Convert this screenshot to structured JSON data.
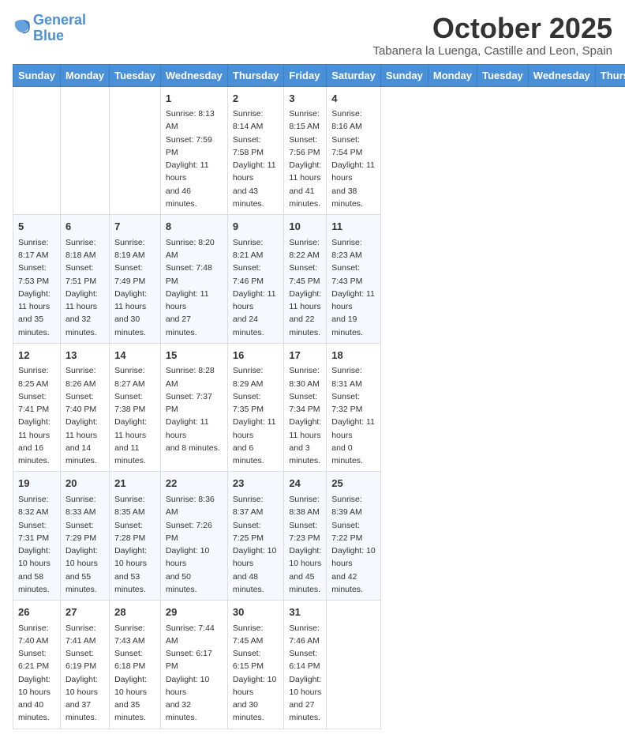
{
  "header": {
    "logo_line1": "General",
    "logo_line2": "Blue",
    "month": "October 2025",
    "location": "Tabanera la Luenga, Castille and Leon, Spain"
  },
  "days_of_week": [
    "Sunday",
    "Monday",
    "Tuesday",
    "Wednesday",
    "Thursday",
    "Friday",
    "Saturday"
  ],
  "weeks": [
    [
      {
        "day": "",
        "info": ""
      },
      {
        "day": "",
        "info": ""
      },
      {
        "day": "",
        "info": ""
      },
      {
        "day": "1",
        "info": "Sunrise: 8:13 AM\nSunset: 7:59 PM\nDaylight: 11 hours\nand 46 minutes."
      },
      {
        "day": "2",
        "info": "Sunrise: 8:14 AM\nSunset: 7:58 PM\nDaylight: 11 hours\nand 43 minutes."
      },
      {
        "day": "3",
        "info": "Sunrise: 8:15 AM\nSunset: 7:56 PM\nDaylight: 11 hours\nand 41 minutes."
      },
      {
        "day": "4",
        "info": "Sunrise: 8:16 AM\nSunset: 7:54 PM\nDaylight: 11 hours\nand 38 minutes."
      }
    ],
    [
      {
        "day": "5",
        "info": "Sunrise: 8:17 AM\nSunset: 7:53 PM\nDaylight: 11 hours\nand 35 minutes."
      },
      {
        "day": "6",
        "info": "Sunrise: 8:18 AM\nSunset: 7:51 PM\nDaylight: 11 hours\nand 32 minutes."
      },
      {
        "day": "7",
        "info": "Sunrise: 8:19 AM\nSunset: 7:49 PM\nDaylight: 11 hours\nand 30 minutes."
      },
      {
        "day": "8",
        "info": "Sunrise: 8:20 AM\nSunset: 7:48 PM\nDaylight: 11 hours\nand 27 minutes."
      },
      {
        "day": "9",
        "info": "Sunrise: 8:21 AM\nSunset: 7:46 PM\nDaylight: 11 hours\nand 24 minutes."
      },
      {
        "day": "10",
        "info": "Sunrise: 8:22 AM\nSunset: 7:45 PM\nDaylight: 11 hours\nand 22 minutes."
      },
      {
        "day": "11",
        "info": "Sunrise: 8:23 AM\nSunset: 7:43 PM\nDaylight: 11 hours\nand 19 minutes."
      }
    ],
    [
      {
        "day": "12",
        "info": "Sunrise: 8:25 AM\nSunset: 7:41 PM\nDaylight: 11 hours\nand 16 minutes."
      },
      {
        "day": "13",
        "info": "Sunrise: 8:26 AM\nSunset: 7:40 PM\nDaylight: 11 hours\nand 14 minutes."
      },
      {
        "day": "14",
        "info": "Sunrise: 8:27 AM\nSunset: 7:38 PM\nDaylight: 11 hours\nand 11 minutes."
      },
      {
        "day": "15",
        "info": "Sunrise: 8:28 AM\nSunset: 7:37 PM\nDaylight: 11 hours\nand 8 minutes."
      },
      {
        "day": "16",
        "info": "Sunrise: 8:29 AM\nSunset: 7:35 PM\nDaylight: 11 hours\nand 6 minutes."
      },
      {
        "day": "17",
        "info": "Sunrise: 8:30 AM\nSunset: 7:34 PM\nDaylight: 11 hours\nand 3 minutes."
      },
      {
        "day": "18",
        "info": "Sunrise: 8:31 AM\nSunset: 7:32 PM\nDaylight: 11 hours\nand 0 minutes."
      }
    ],
    [
      {
        "day": "19",
        "info": "Sunrise: 8:32 AM\nSunset: 7:31 PM\nDaylight: 10 hours\nand 58 minutes."
      },
      {
        "day": "20",
        "info": "Sunrise: 8:33 AM\nSunset: 7:29 PM\nDaylight: 10 hours\nand 55 minutes."
      },
      {
        "day": "21",
        "info": "Sunrise: 8:35 AM\nSunset: 7:28 PM\nDaylight: 10 hours\nand 53 minutes."
      },
      {
        "day": "22",
        "info": "Sunrise: 8:36 AM\nSunset: 7:26 PM\nDaylight: 10 hours\nand 50 minutes."
      },
      {
        "day": "23",
        "info": "Sunrise: 8:37 AM\nSunset: 7:25 PM\nDaylight: 10 hours\nand 48 minutes."
      },
      {
        "day": "24",
        "info": "Sunrise: 8:38 AM\nSunset: 7:23 PM\nDaylight: 10 hours\nand 45 minutes."
      },
      {
        "day": "25",
        "info": "Sunrise: 8:39 AM\nSunset: 7:22 PM\nDaylight: 10 hours\nand 42 minutes."
      }
    ],
    [
      {
        "day": "26",
        "info": "Sunrise: 7:40 AM\nSunset: 6:21 PM\nDaylight: 10 hours\nand 40 minutes."
      },
      {
        "day": "27",
        "info": "Sunrise: 7:41 AM\nSunset: 6:19 PM\nDaylight: 10 hours\nand 37 minutes."
      },
      {
        "day": "28",
        "info": "Sunrise: 7:43 AM\nSunset: 6:18 PM\nDaylight: 10 hours\nand 35 minutes."
      },
      {
        "day": "29",
        "info": "Sunrise: 7:44 AM\nSunset: 6:17 PM\nDaylight: 10 hours\nand 32 minutes."
      },
      {
        "day": "30",
        "info": "Sunrise: 7:45 AM\nSunset: 6:15 PM\nDaylight: 10 hours\nand 30 minutes."
      },
      {
        "day": "31",
        "info": "Sunrise: 7:46 AM\nSunset: 6:14 PM\nDaylight: 10 hours\nand 27 minutes."
      },
      {
        "day": "",
        "info": ""
      }
    ]
  ]
}
